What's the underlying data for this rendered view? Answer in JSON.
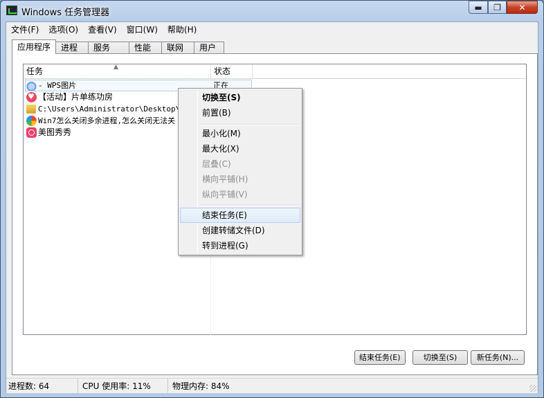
{
  "window": {
    "title": "Windows 任务管理器",
    "caption_minimize": "▬",
    "caption_maximize": "❐",
    "caption_close": "✕"
  },
  "menu": [
    "文件(F)",
    "选项(O)",
    "查看(V)",
    "窗口(W)",
    "帮助(H)"
  ],
  "tabs": [
    "应用程序",
    "进程",
    "服务",
    "性能",
    "联网",
    "用户"
  ],
  "list": {
    "columns": {
      "task": "任务",
      "status": "状态"
    },
    "rows": [
      {
        "icon": "cloud-icon",
        "task": " - WPS图片",
        "status": "正在"
      },
      {
        "icon": "heart-icon",
        "task": "【活动】片单练功房",
        "status": ""
      },
      {
        "icon": "folder-icon",
        "task": "C:\\Users\\Administrator\\Desktop\\新建",
        "status": ""
      },
      {
        "icon": "colorful-ball-icon",
        "task": "Win7怎么关闭多余进程,怎么关闭无法关",
        "status": ""
      },
      {
        "icon": "meitu-icon",
        "task": "美图秀秀",
        "status": ""
      }
    ]
  },
  "context_menu": {
    "items": [
      {
        "label": "切换至(S)",
        "state": "bold"
      },
      {
        "label": "前置(B)",
        "state": "normal"
      },
      {
        "label": "最小化(M)",
        "state": "normal"
      },
      {
        "label": "最大化(X)",
        "state": "normal"
      },
      {
        "label": "层叠(C)",
        "state": "disabled"
      },
      {
        "label": "横向平铺(H)",
        "state": "disabled"
      },
      {
        "label": "纵向平铺(V)",
        "state": "disabled"
      },
      {
        "label": "结束任务(E)",
        "state": "hover"
      },
      {
        "label": "创建转储文件(D)",
        "state": "normal"
      },
      {
        "label": "转到进程(G)",
        "state": "normal"
      }
    ]
  },
  "buttons": {
    "end_task": "结束任务(E)",
    "switch_to": "切换至(S)",
    "new_task": "新任务(N)..."
  },
  "status": {
    "processes": "进程数: 64",
    "cpu": "CPU 使用率: 11%",
    "memory": "物理内存: 84%"
  }
}
